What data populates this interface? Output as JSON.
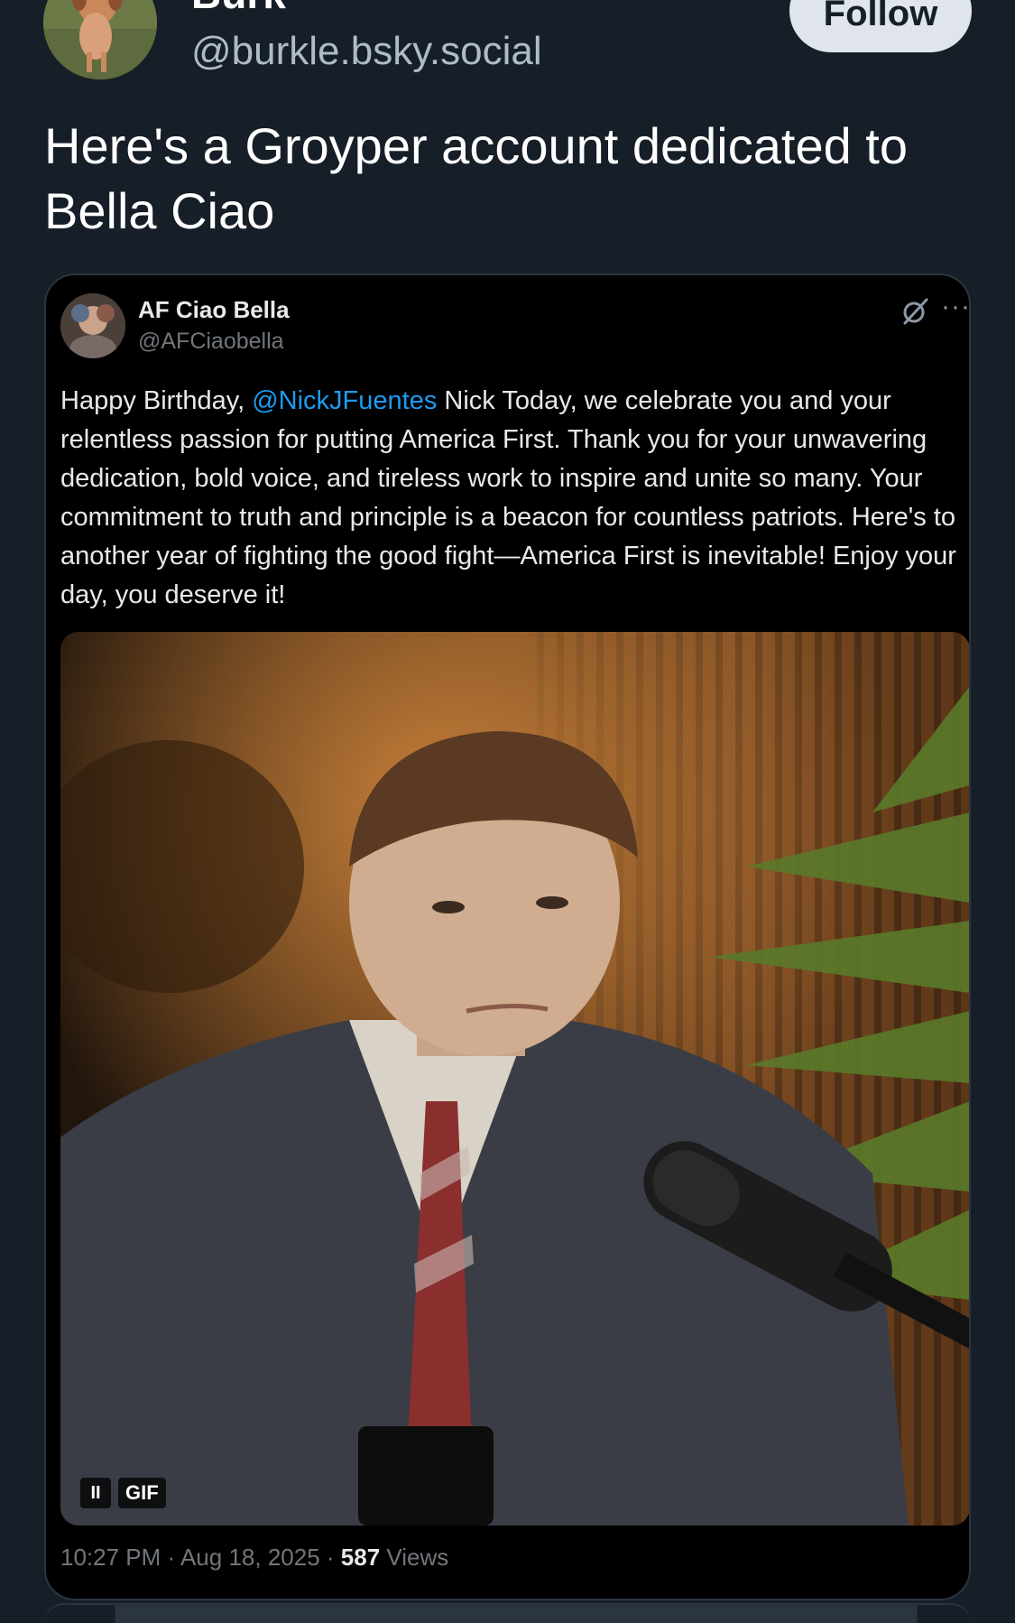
{
  "author": {
    "display_name": "Burk",
    "handle": "@burkle.bsky.social",
    "follow_label": "Follow"
  },
  "post": {
    "text": "Here's a Groyper account dedicated to Bella Ciao"
  },
  "quoted": {
    "name": "AF Ciao Bella",
    "handle": "@AFCiaobella",
    "more_label": "···",
    "body_prefix": "Happy Birthday, ",
    "mention": "@NickJFuentes",
    "body_rest": " Nick  Today, we celebrate you and your relentless passion for putting America First. Thank you for your unwavering dedication, bold voice, and tireless work to inspire and unite so many. Your commitment to truth and principle is a beacon for countless patriots. Here's to another year of fighting the good fight—America First is inevitable!  Enjoy your day, you deserve it!",
    "media": {
      "pause_label": "II",
      "gif_label": "GIF"
    },
    "meta": {
      "time": "10:27 PM",
      "date": "Aug 18, 2025",
      "views_count": "587",
      "views_label": "Views",
      "separator": " · "
    }
  },
  "colors": {
    "background": "#161e27",
    "card_background": "#000000",
    "mention": "#1d9bf0",
    "follow_button": "#dfe5ea"
  },
  "icons": [
    "dog-avatar-icon",
    "grok-icon",
    "more-options-icon",
    "pause-icon"
  ]
}
